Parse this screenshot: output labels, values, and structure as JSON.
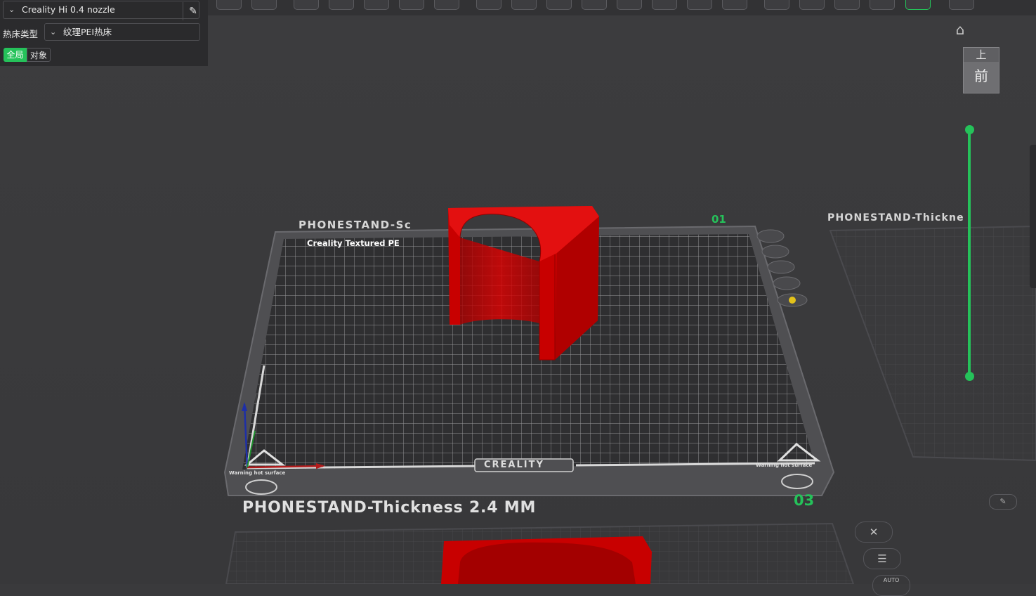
{
  "printer": {
    "name": "Creality Hi 0.4 nozzle"
  },
  "bed": {
    "label": "热床类型",
    "value": "纹理PEI热床"
  },
  "scope_tabs": {
    "global": "全局",
    "object": "对象"
  },
  "view_cube": {
    "top": "上",
    "front": "前"
  },
  "plates": {
    "main_name": "PHONESTAND-Sc",
    "main_number": "01",
    "right_name": "PHONESTAND-Thickne",
    "bottom_name": "PHONESTAND-Thickness 2.4 MM",
    "bottom_number": "03"
  },
  "bed_print": {
    "surface_label": "Creality Textured PE",
    "brand": "CREALITY",
    "warning_left": "Warning hot surface",
    "warning_right": "Warning hot surface"
  },
  "bottom_tools": {
    "auto_label": "AUTO"
  },
  "colors": {
    "model": "#d40000",
    "accent": "#25c25a",
    "bed": "#555557"
  }
}
